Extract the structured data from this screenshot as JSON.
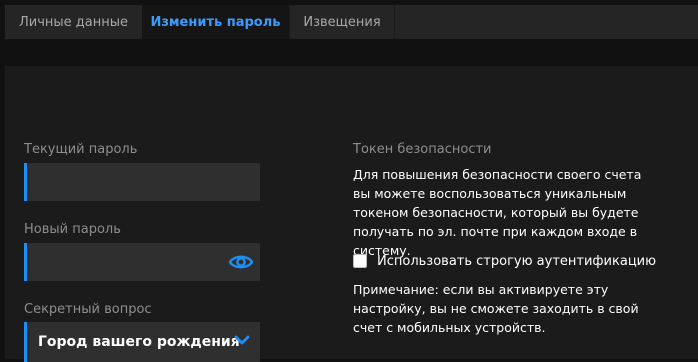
{
  "tabs": [
    {
      "label": "Личные данные",
      "active": false
    },
    {
      "label": "Изменить пароль",
      "active": true
    },
    {
      "label": "Извещения",
      "active": false
    }
  ],
  "form": {
    "current_password_label": "Текущий пароль",
    "current_password_value": "",
    "new_password_label": "Новый пароль",
    "new_password_value": "",
    "secret_question_label": "Секретный вопрос",
    "secret_question_selected": "Город вашего рождения"
  },
  "token": {
    "title": "Токен безопасности",
    "description": "Для повышения безопасности своего счета вы можете воспользоваться уникальным токеном безопасности, который вы будете получать по эл. почте при каждом входе в систему.",
    "checkbox_label": "Использовать строгую аутентификацию",
    "checkbox_checked": false,
    "note": "Примечание: если вы активируете эту настройку, вы не сможете заходить в свой счет с мобильных устройств."
  },
  "colors": {
    "accent": "#1e8ff5",
    "active_tab_text": "#3b9cff",
    "background": "#111111"
  },
  "icons": {
    "show_password": "eye-icon",
    "dropdown": "chevron-down-icon"
  }
}
